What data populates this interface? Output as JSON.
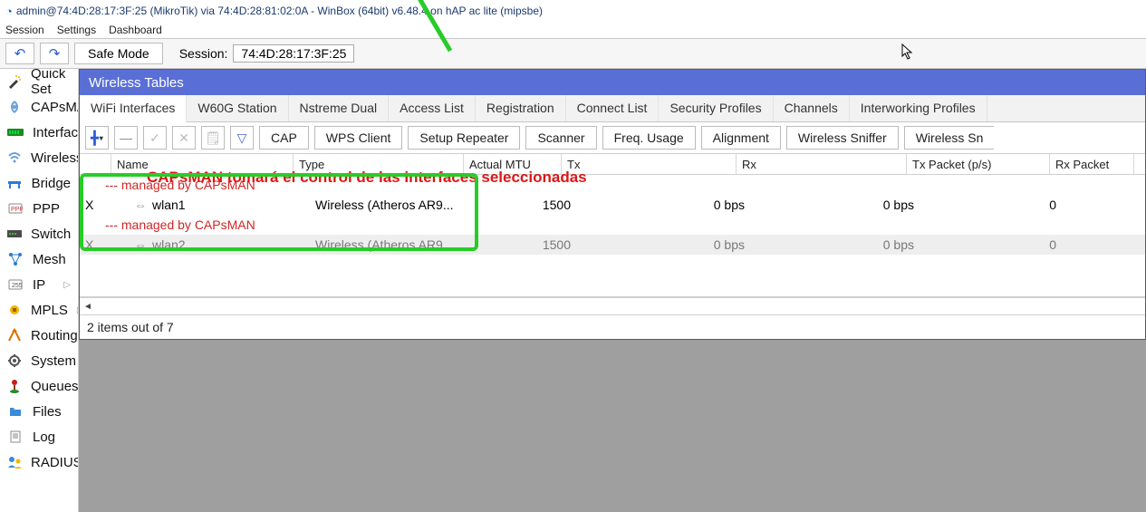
{
  "window": {
    "title": "admin@74:4D:28:17:3F:25 (MikroTik) via 74:4D:28:81:02:0A - WinBox (64bit) v6.48.4 on hAP ac lite (mipsbe)"
  },
  "menu": {
    "session": "Session",
    "settings": "Settings",
    "dashboard": "Dashboard"
  },
  "toolbar": {
    "undo": "↶",
    "redo": "↷",
    "safe_mode": "Safe Mode",
    "session_label": "Session:",
    "session_value": "74:4D:28:17:3F:25"
  },
  "sidebar": [
    {
      "icon": "wand",
      "label": "Quick Set",
      "sub": false
    },
    {
      "icon": "radio",
      "label": "CAPsMAN",
      "sub": false
    },
    {
      "icon": "iface",
      "label": "Interfaces",
      "sub": false
    },
    {
      "icon": "wifi",
      "label": "Wireless",
      "sub": false
    },
    {
      "icon": "bridge",
      "label": "Bridge",
      "sub": false
    },
    {
      "icon": "ppp",
      "label": "PPP",
      "sub": false
    },
    {
      "icon": "switch",
      "label": "Switch",
      "sub": false
    },
    {
      "icon": "mesh",
      "label": "Mesh",
      "sub": false
    },
    {
      "icon": "ip",
      "label": "IP",
      "sub": true
    },
    {
      "icon": "mpls",
      "label": "MPLS",
      "sub": true
    },
    {
      "icon": "routing",
      "label": "Routing",
      "sub": true
    },
    {
      "icon": "system",
      "label": "System",
      "sub": true
    },
    {
      "icon": "queues",
      "label": "Queues",
      "sub": false
    },
    {
      "icon": "files",
      "label": "Files",
      "sub": false
    },
    {
      "icon": "log",
      "label": "Log",
      "sub": false
    },
    {
      "icon": "radius",
      "label": "RADIUS",
      "sub": false
    }
  ],
  "panel": {
    "title": "Wireless Tables"
  },
  "tabs": [
    "WiFi Interfaces",
    "W60G Station",
    "Nstreme Dual",
    "Access List",
    "Registration",
    "Connect List",
    "Security Profiles",
    "Channels",
    "Interworking Profiles"
  ],
  "active_tab": 0,
  "subbar": {
    "cap": "CAP",
    "wps": "WPS Client",
    "setup": "Setup Repeater",
    "scanner": "Scanner",
    "freq": "Freq. Usage",
    "align": "Alignment",
    "sniffer": "Wireless Sniffer",
    "snoop": "Wireless Sn"
  },
  "columns": {
    "name": "Name",
    "type": "Type",
    "mtu": "Actual MTU",
    "tx": "Tx",
    "rx": "Rx",
    "txp": "Tx Packet (p/s)",
    "rxp": "Rx Packet"
  },
  "managed_text": "--- managed by CAPsMAN",
  "rows": [
    {
      "flag": "X",
      "name": "wlan1",
      "type": "Wireless (Atheros AR9...",
      "mtu": "1500",
      "tx": "0 bps",
      "rx": "0 bps",
      "txp": "0",
      "rxp": ""
    },
    {
      "flag": "X",
      "name": "wlan2",
      "type": "Wireless (Atheros AR9...",
      "mtu": "1500",
      "tx": "0 bps",
      "rx": "0 bps",
      "txp": "0",
      "rxp": ""
    }
  ],
  "status": "2 items out of 7",
  "annotation": "CAPsMAN tomará el control de las interfaces seleccionadas"
}
